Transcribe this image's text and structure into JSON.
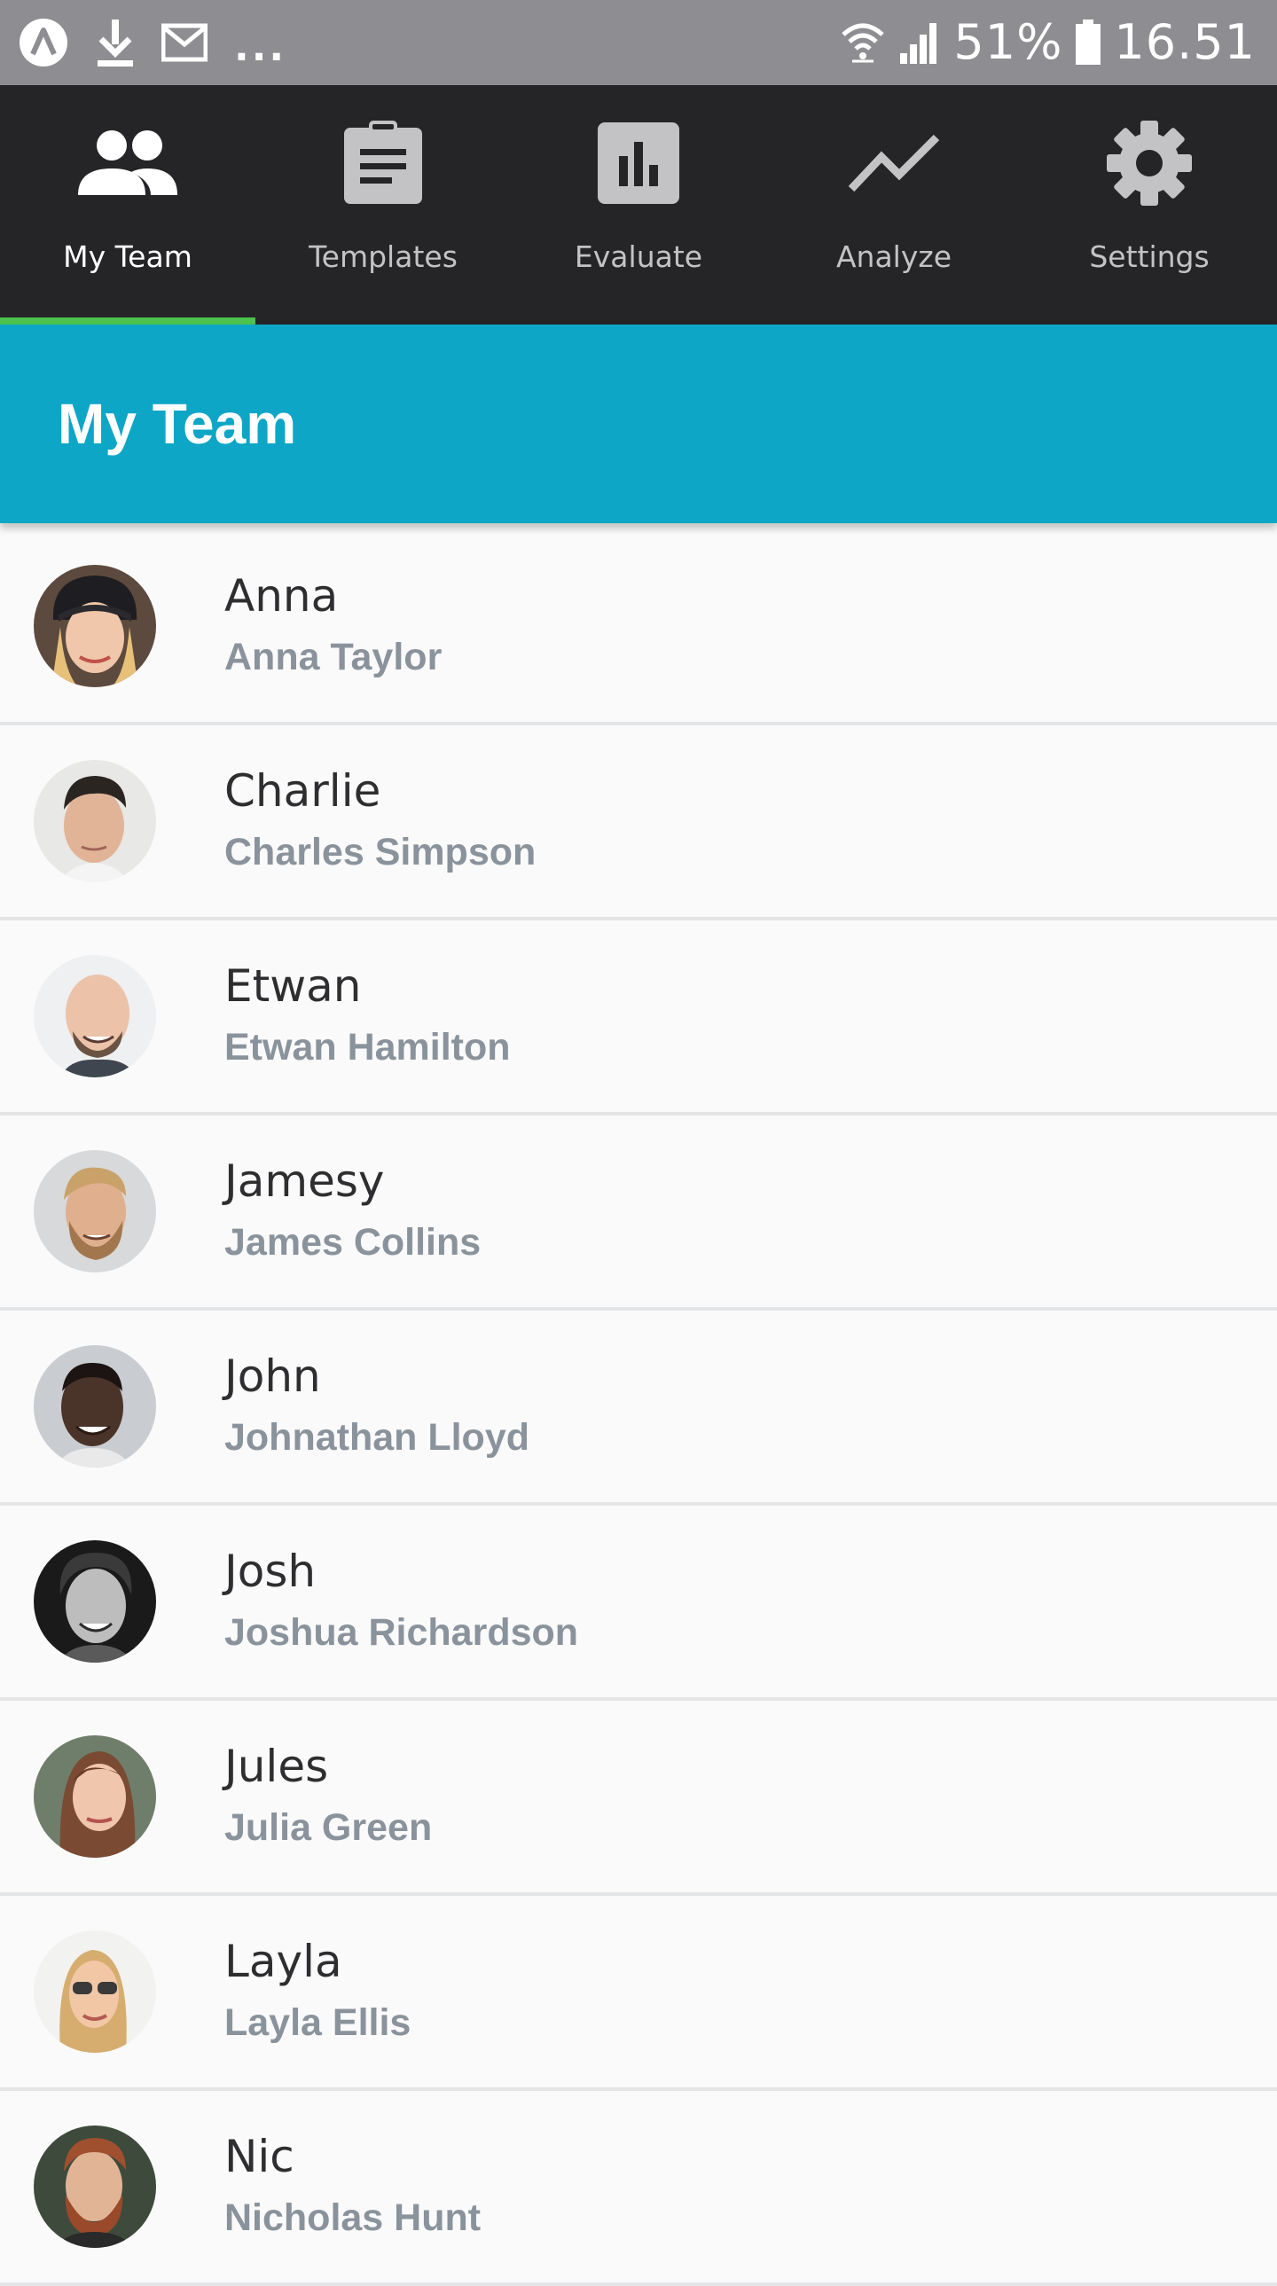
{
  "status_bar": {
    "left_icons": [
      "app-icon",
      "download-icon",
      "gmail-icon"
    ],
    "more": "...",
    "battery_percent": "51%",
    "time": "16.51"
  },
  "nav": {
    "items": [
      {
        "label": "My Team",
        "icon": "people-icon",
        "active": true
      },
      {
        "label": "Templates",
        "icon": "clipboard-icon",
        "active": false
      },
      {
        "label": "Evaluate",
        "icon": "bar-chart-icon",
        "active": false
      },
      {
        "label": "Analyze",
        "icon": "trend-line-icon",
        "active": false
      },
      {
        "label": "Settings",
        "icon": "gear-icon",
        "active": false
      }
    ],
    "active_color": "#4cc24f"
  },
  "title_bar": {
    "title": "My Team",
    "color": "#0ea6c6"
  },
  "team": {
    "members": [
      {
        "nickname": "Anna",
        "full_name": "Anna Taylor"
      },
      {
        "nickname": "Charlie",
        "full_name": "Charles Simpson"
      },
      {
        "nickname": "Etwan",
        "full_name": "Etwan Hamilton"
      },
      {
        "nickname": "Jamesy",
        "full_name": "James Collins"
      },
      {
        "nickname": "John",
        "full_name": "Johnathan Lloyd"
      },
      {
        "nickname": "Josh",
        "full_name": "Joshua Richardson"
      },
      {
        "nickname": "Jules",
        "full_name": "Julia Green"
      },
      {
        "nickname": "Layla",
        "full_name": "Layla Ellis"
      },
      {
        "nickname": "Nic",
        "full_name": "Nicholas Hunt"
      }
    ]
  }
}
